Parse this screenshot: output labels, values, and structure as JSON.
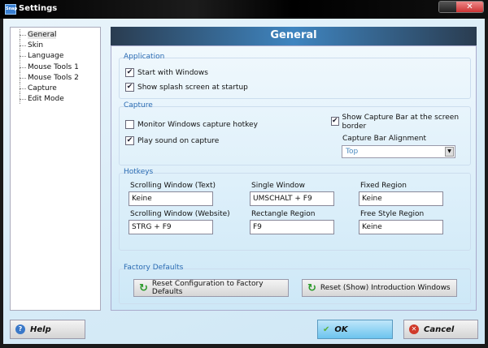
{
  "window": {
    "title": "Settings",
    "app_icon": "Snap",
    "close": "✕"
  },
  "tree": [
    "General",
    "Skin",
    "Language",
    "Mouse Tools 1",
    "Mouse Tools 2",
    "Capture",
    "Edit Mode"
  ],
  "header": "General",
  "application": {
    "legend": "Application",
    "start_with_windows": "Start with Windows",
    "splash": "Show splash screen at startup"
  },
  "capture": {
    "legend": "Capture",
    "monitor": "Monitor Windows capture hotkey",
    "sound": "Play sound on capture",
    "show_bar": "Show Capture Bar at the screen border",
    "alignment_label": "Capture Bar Alignment",
    "alignment_value": "Top"
  },
  "hotkeys": {
    "legend": "Hotkeys",
    "items": [
      {
        "label": "Scrolling Window (Text)",
        "value": "Keine"
      },
      {
        "label": "Single Window",
        "value": "UMSCHALT + F9"
      },
      {
        "label": "Fixed Region",
        "value": "Keine"
      },
      {
        "label": "Scrolling Window (Website)",
        "value": "STRG + F9"
      },
      {
        "label": "Rectangle Region",
        "value": "F9"
      },
      {
        "label": "Free Style Region",
        "value": "Keine"
      }
    ]
  },
  "factory": {
    "legend": "Factory Defaults",
    "reset_config": "Reset Configuration to Factory Defaults",
    "reset_intro": "Reset (Show) Introduction Windows"
  },
  "footer": {
    "help": "Help",
    "ok": "OK",
    "cancel": "Cancel"
  },
  "checks": {
    "on": "✔"
  }
}
